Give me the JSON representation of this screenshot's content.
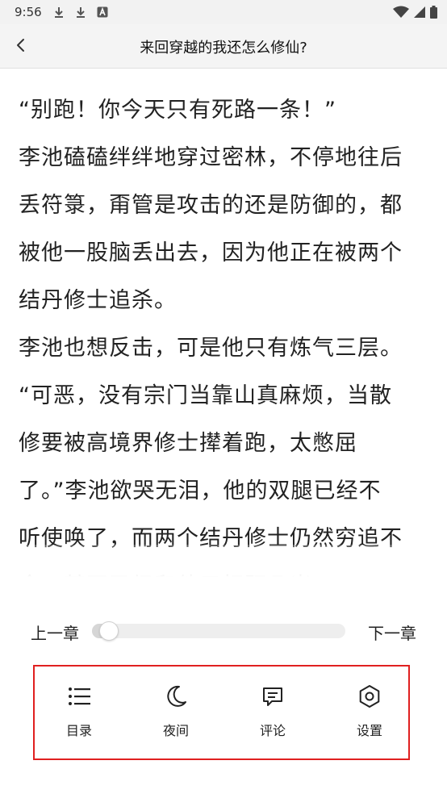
{
  "status_bar": {
    "time": "9:56",
    "notification_icons": [
      "download-icon",
      "download-icon",
      "app-a-icon"
    ],
    "system_icons": [
      "wifi-icon",
      "signal-icon",
      "battery-icon"
    ]
  },
  "header": {
    "title": "来回穿越的我还怎么修仙?",
    "back_icon": "chevron-left-icon"
  },
  "content": {
    "lines": [
      "“别跑！你今天只有死路一条！”",
      "李池磕磕绊绊地穿过密林，不停地往后",
      "丢符箓，甭管是攻击的还是防御的，都",
      "被他一股脑丢出去，因为他正在被两个",
      "结丹修士追杀。",
      "李池也想反击，可是他只有炼气三层。",
      "“可恶，没有宗门当靠山真麻烦，当散",
      "修要被高境界修士撵着跑，太憋屈",
      "了。”李池欲哭无泪，他的双腿已经不",
      "听使唤了，而两个结丹修士仍然穷追不",
      "舍，甚至已经和他只相距几米。"
    ]
  },
  "chapter_nav": {
    "prev_label": "上一章",
    "next_label": "下一章",
    "progress": 0.03
  },
  "menu": {
    "items": [
      {
        "label": "目录",
        "icon": "list-icon"
      },
      {
        "label": "夜间",
        "icon": "moon-icon"
      },
      {
        "label": "评论",
        "icon": "comment-icon"
      },
      {
        "label": "设置",
        "icon": "settings-icon"
      }
    ],
    "highlight_color": "#e02020"
  }
}
